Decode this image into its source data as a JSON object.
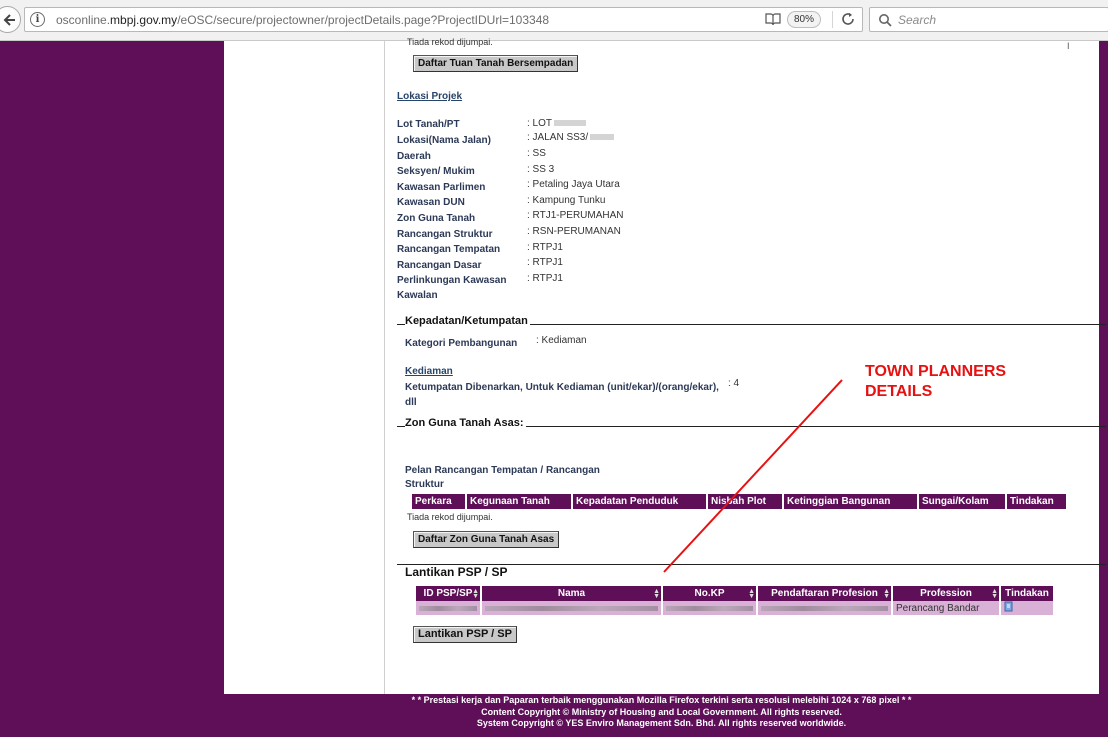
{
  "browser": {
    "url_prefix": "osconline.",
    "url_domain": "mbpj.gov.my",
    "url_path": "/eOSC/secure/projectowner/projectDetails.page?ProjectIDUrl=103348",
    "zoom": "80%",
    "search_placeholder": "Search"
  },
  "top": {
    "no_record_text": "Tiada rekod dijumpai.",
    "scroll_marker": "I",
    "button_neighbour_owner": "Daftar Tuan Tanah Bersempadan"
  },
  "lokasi": {
    "heading": "Lokasi Projek",
    "rows": [
      {
        "label": "Lot Tanah/PT",
        "value": ": LOT"
      },
      {
        "label": "Lokasi(Nama Jalan)",
        "value": ": JALAN SS3/"
      },
      {
        "label": "Daerah",
        "value": ": SS"
      },
      {
        "label": "Seksyen/ Mukim",
        "value": ": SS 3"
      },
      {
        "label": "Kawasan Parlimen",
        "value": ": Petaling Jaya Utara"
      },
      {
        "label": "Kawasan DUN",
        "value": ": Kampung Tunku"
      },
      {
        "label": "Zon Guna Tanah",
        "value": ": RTJ1-PERUMAHAN"
      },
      {
        "label": "Rancangan Struktur",
        "value": ": RSN-PERUMANAN"
      },
      {
        "label": "Rancangan Tempatan",
        "value": ": RTPJ1"
      },
      {
        "label": "Rancangan Dasar",
        "value": ": RTPJ1"
      },
      {
        "label": "Perlinkungan Kawasan",
        "label2": "Kawalan",
        "value": ": RTPJ1"
      }
    ]
  },
  "kepadatan": {
    "legend": "Kepadatan/Ketumpatan",
    "kategori_label": "Kategori Pembangunan",
    "kategori_value": ": Kediaman",
    "sub_heading": "Kediaman",
    "ketumpatan_label": "Ketumpatan Dibenarkan, Untuk Kediaman (unit/ekar)/(orang/ekar),",
    "ketumpatan_label2": "dll",
    "ketumpatan_value": ": 4"
  },
  "zon": {
    "legend": "Zon Guna Tanah Asas:",
    "pelan_label": "Pelan Rancangan Tempatan / Rancangan",
    "pelan_label2": "Struktur",
    "columns": [
      "Perkara",
      "Kegunaan Tanah",
      "Kepadatan Penduduk",
      "Nisbah Plot",
      "Ketinggian Bangunan",
      "Sungai/Kolam",
      "Tindakan"
    ],
    "no_record_text": "Tiada rekod dijumpai.",
    "button": "Daftar Zon Guna Tanah Asas"
  },
  "psp": {
    "legend": "Lantikan PSP / SP",
    "columns": [
      "ID PSP/SP",
      "Nama",
      "No.KP",
      "Pendaftaran Profesion",
      "Profession",
      "Tindakan"
    ],
    "rows": [
      {
        "profession": "Perancang Bandar"
      }
    ],
    "button": "Lantikan PSP / SP"
  },
  "annotation": {
    "line1": "TOWN PLANNERS",
    "line2": "DETAILS",
    "color": "#e81010"
  },
  "footer": {
    "line1": "* * Prestasi kerja dan Paparan terbaik menggunakan Mozilla Firefox terkini serta resolusi melebihi 1024 x 768 pixel * *",
    "line2": "Content Copyright © Ministry of Housing and Local Government. All rights reserved.",
    "line3": "System Copyright © YES Enviro Management Sdn. Bhd. All rights reserved worldwide."
  },
  "colors": {
    "brand_purple": "#5e0f58",
    "row_pink": "#d9b0d6",
    "link_blue": "#27456a"
  }
}
